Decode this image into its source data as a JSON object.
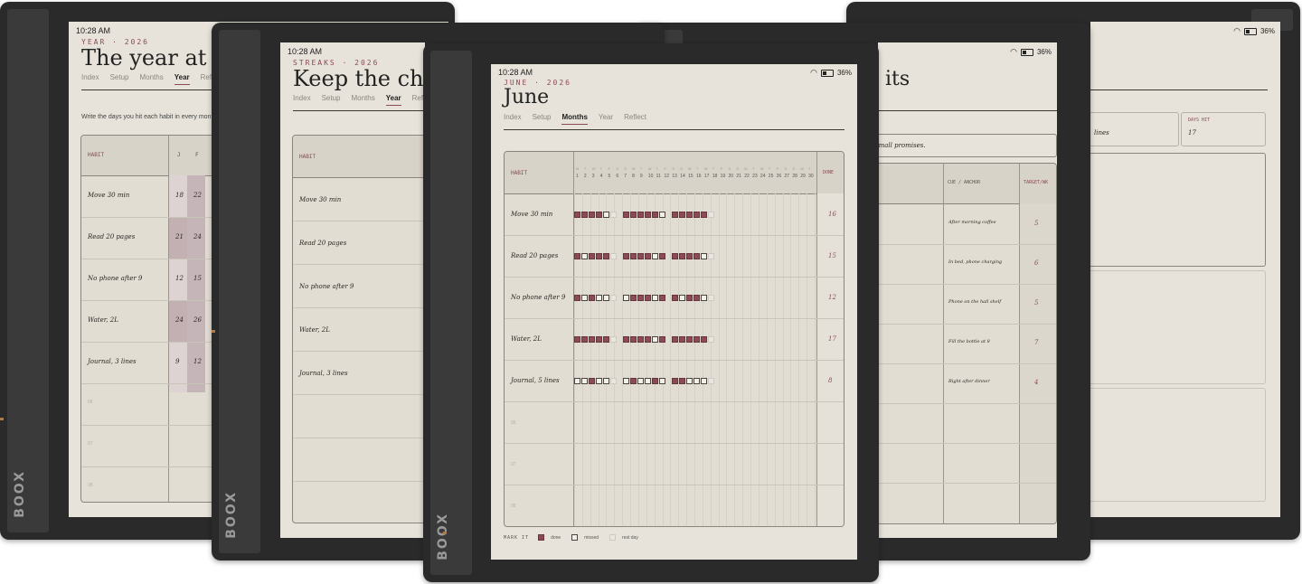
{
  "status": {
    "time": "10:28 AM",
    "battery": "36%"
  },
  "brand": "BOOX",
  "tabs": [
    "Index",
    "Setup",
    "Months",
    "Year",
    "Reflect"
  ],
  "back_left": {
    "kicker": "YEAR · 2026",
    "title": "The year at a",
    "active_tab": "Year",
    "instruction": "Write the days you hit each habit in every month, th",
    "col_habit": "HABIT",
    "col_months": [
      "J",
      "F"
    ],
    "rows": [
      {
        "habit": "Move 30 min",
        "v": [
          "18",
          "22"
        ]
      },
      {
        "habit": "Read 20 pages",
        "v": [
          "21",
          "24"
        ]
      },
      {
        "habit": "No phone after 9",
        "v": [
          "12",
          "15"
        ]
      },
      {
        "habit": "Water, 2L",
        "v": [
          "24",
          "26"
        ]
      },
      {
        "habit": "Journal, 3 lines",
        "v": [
          "9",
          "12"
        ]
      }
    ],
    "empty_rows": [
      "06",
      "07",
      "08"
    ]
  },
  "mid_left": {
    "kicker": "STREAKS · 2026",
    "title": "Keep the chai",
    "active_tab": "Year",
    "col_habit": "HABIT",
    "rows": [
      "Move 30 min",
      "Read 20 pages",
      "No phone after 9",
      "Water, 2L",
      "Journal, 3 lines"
    ]
  },
  "mid_right": {
    "title": "its",
    "prompt": "small promises.",
    "col_cue": "CUE / ANCHOR",
    "col_target": "TARGET/WK",
    "rows": [
      {
        "cue": "After morning coffee",
        "target": "5"
      },
      {
        "cue": "In bed, phone charging",
        "target": "6"
      },
      {
        "cue": "Phone on the hall shelf",
        "target": "5"
      },
      {
        "cue": "Fill the bottle at 8",
        "target": "7"
      },
      {
        "cue": "Right after dinner",
        "target": "4"
      }
    ]
  },
  "back_right": {
    "label_left_value": "lines",
    "days_hit_label": "DAYS HIT",
    "days_hit_value": "17"
  },
  "front": {
    "kicker": "JUNE · 2026",
    "title": "June",
    "active_tab": "Months",
    "col_habit": "HABIT",
    "col_done": "DONE",
    "weekday_letters": [
      "M",
      "T",
      "W",
      "T",
      "F",
      "S",
      "S",
      "M",
      "T",
      "W",
      "T",
      "F",
      "S",
      "S",
      "M",
      "T",
      "W",
      "T",
      "F",
      "S",
      "S",
      "M",
      "T",
      "W",
      "T",
      "F",
      "S",
      "S",
      "M",
      "T"
    ],
    "rows": [
      {
        "habit": "Move 30 min",
        "pattern": "ddddmr-dddddm-dddddr",
        "done": "16"
      },
      {
        "habit": "Read 20 pages",
        "pattern": "dmdddr-ddddmd-ddddmr",
        "done": "15"
      },
      {
        "habit": "No phone after 9",
        "pattern": "dmdmmr-mdddmd-dmddmr",
        "done": "12"
      },
      {
        "habit": "Water, 2L",
        "pattern": "dddddr-ddddmd-dddddr",
        "done": "17"
      },
      {
        "habit": "Journal, 5 lines",
        "pattern": "mmdmmr-mdmmdm-ddmmmr",
        "done": "8"
      }
    ],
    "empty_rows": [
      "06",
      "07",
      "08"
    ],
    "legend": {
      "title": "MARK IT",
      "done": "done",
      "missed": "missed",
      "rest": "rest day"
    }
  }
}
